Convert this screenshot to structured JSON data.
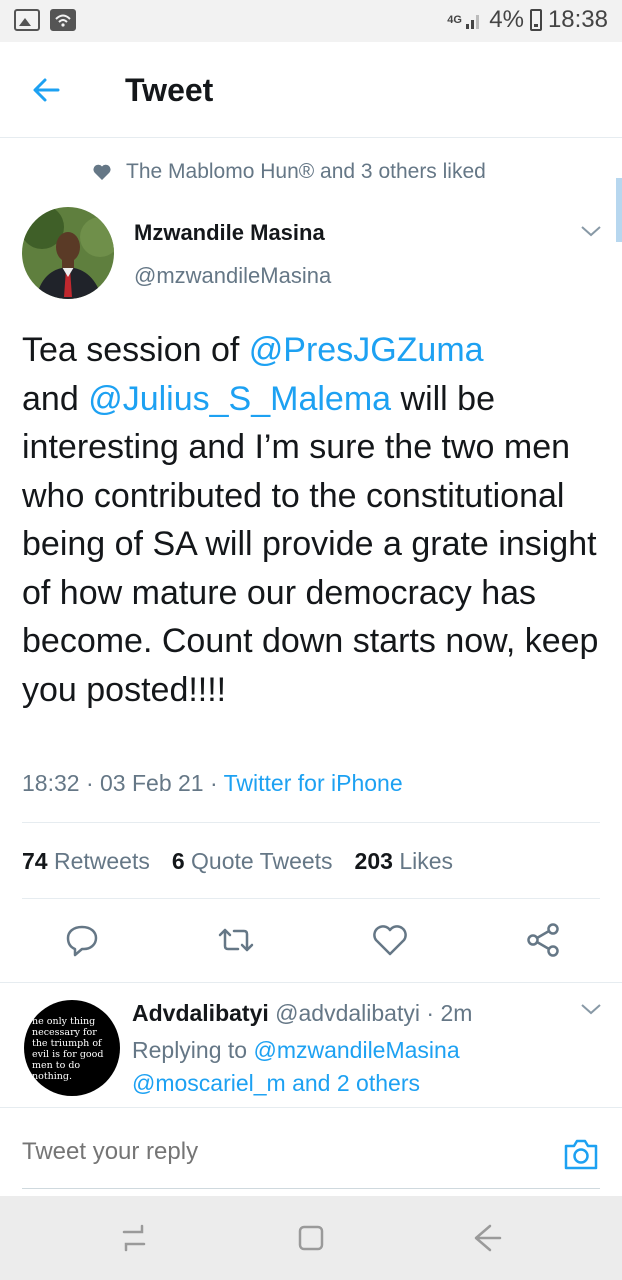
{
  "status_bar": {
    "network": "4G",
    "battery": "4%",
    "time": "18:38"
  },
  "header": {
    "title": "Tweet"
  },
  "social_context": {
    "text": "The Mablomo Hun® and 3 others liked"
  },
  "tweet": {
    "author_name": "Mzwandile Masina",
    "author_handle": "@mzwandileMasina",
    "text_parts": {
      "p1": "Tea session of ",
      "m1": "@PresJGZuma",
      "p2": " and ",
      "m2": "@Julius_S_Malema",
      "p3": " will be interesting and I’m sure the two men who contributed to the constitutional being of SA will provide a grate insight of how mature our democracy has become. Count down starts now, keep you posted!!!!"
    },
    "time": "18:32",
    "date": "03 Feb 21",
    "source": "Twitter for iPhone"
  },
  "stats": {
    "retweets_count": "74",
    "retweets_label": "Retweets",
    "quotes_count": "6",
    "quotes_label": "Quote Tweets",
    "likes_count": "203",
    "likes_label": "Likes"
  },
  "reply": {
    "avatar_text": "he only thing necessary for the triumph of evil is for good men to do nothing.",
    "author_name": "Advdalibatyi",
    "author_handle": "@advdalibatyi",
    "age": "2m",
    "replying_prefix": "Replying to ",
    "replying_mention": "@mzwandileMasina",
    "others": "@moscariel_m and 2 others"
  },
  "composer": {
    "placeholder": "Tweet your reply"
  },
  "colors": {
    "accent": "#1da1f2",
    "secondary_text": "#657786",
    "primary_text": "#14171a"
  }
}
